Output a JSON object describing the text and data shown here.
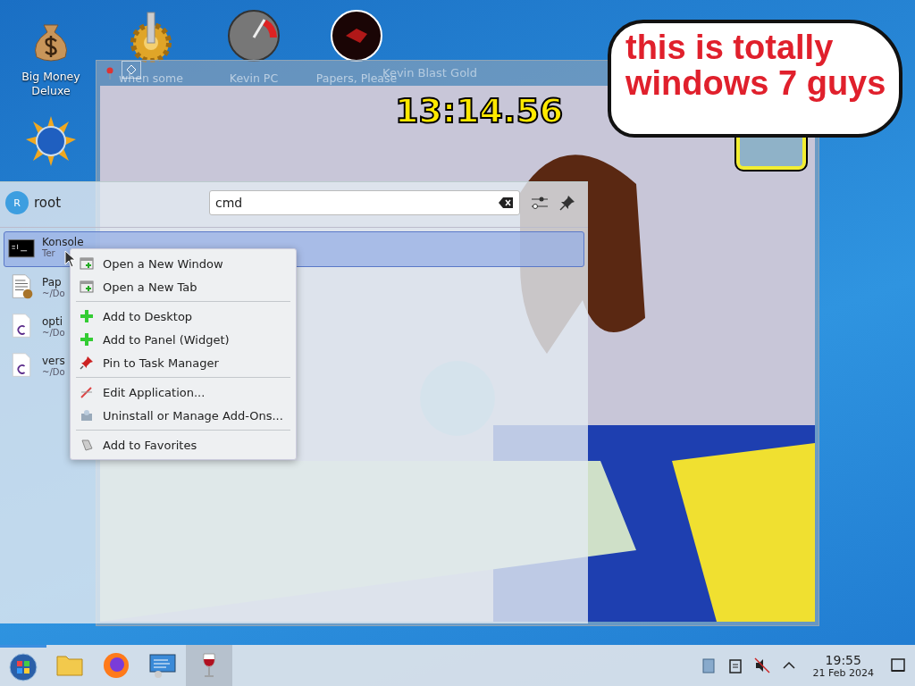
{
  "desktop_icons": [
    {
      "kind": "moneybag",
      "label": "Big Money Deluxe"
    },
    {
      "kind": "gear",
      "label": "when some"
    },
    {
      "kind": "gauge",
      "label": "Kevin PC"
    },
    {
      "kind": "disc",
      "label": "Papers, Please"
    },
    {
      "kind": "sun"
    }
  ],
  "speech_bubble": {
    "lines": [
      "this is totally",
      "windows 7 guys"
    ]
  },
  "game_window": {
    "title": "Kevin Blast Gold",
    "timer": "13:14.56"
  },
  "launcher": {
    "user": {
      "initial": "R",
      "name": "root"
    },
    "search": {
      "value": "cmd"
    },
    "results": [
      {
        "kind": "terminal",
        "title": "Konsole",
        "subtitle": "Ter",
        "selected": true
      },
      {
        "kind": "document",
        "title": "Pap",
        "subtitle": "~/Do",
        "selected": false
      },
      {
        "kind": "source",
        "title": "opti",
        "subtitle": "~/Do",
        "selected": false
      },
      {
        "kind": "source",
        "title": "vers",
        "subtitle": "~/Do",
        "selected": false
      }
    ]
  },
  "context_menu": [
    [
      {
        "kind": "window-add",
        "label": "Open a New Window"
      },
      {
        "kind": "tab-add",
        "label": "Open a New Tab"
      }
    ],
    [
      {
        "kind": "plus",
        "label": "Add to Desktop"
      },
      {
        "kind": "plus",
        "label": "Add to Panel (Widget)"
      },
      {
        "kind": "pin",
        "label": "Pin to Task Manager"
      }
    ],
    [
      {
        "kind": "edit",
        "label": "Edit Application..."
      },
      {
        "kind": "package",
        "label": "Uninstall or Manage Add-Ons..."
      }
    ],
    [
      {
        "kind": "favorite",
        "label": "Add to Favorites"
      }
    ]
  ],
  "taskbar": {
    "apps": [
      {
        "kind": "start",
        "active": true
      },
      {
        "kind": "folder",
        "active": false
      },
      {
        "kind": "browser",
        "active": false
      },
      {
        "kind": "settings",
        "active": false
      },
      {
        "kind": "wine",
        "active": true
      }
    ],
    "tray": [
      {
        "kind": "notes"
      },
      {
        "kind": "clipboard"
      },
      {
        "kind": "muted"
      },
      {
        "kind": "expand"
      }
    ],
    "clock": {
      "time": "19:55",
      "date": "21 Feb 2024"
    }
  }
}
